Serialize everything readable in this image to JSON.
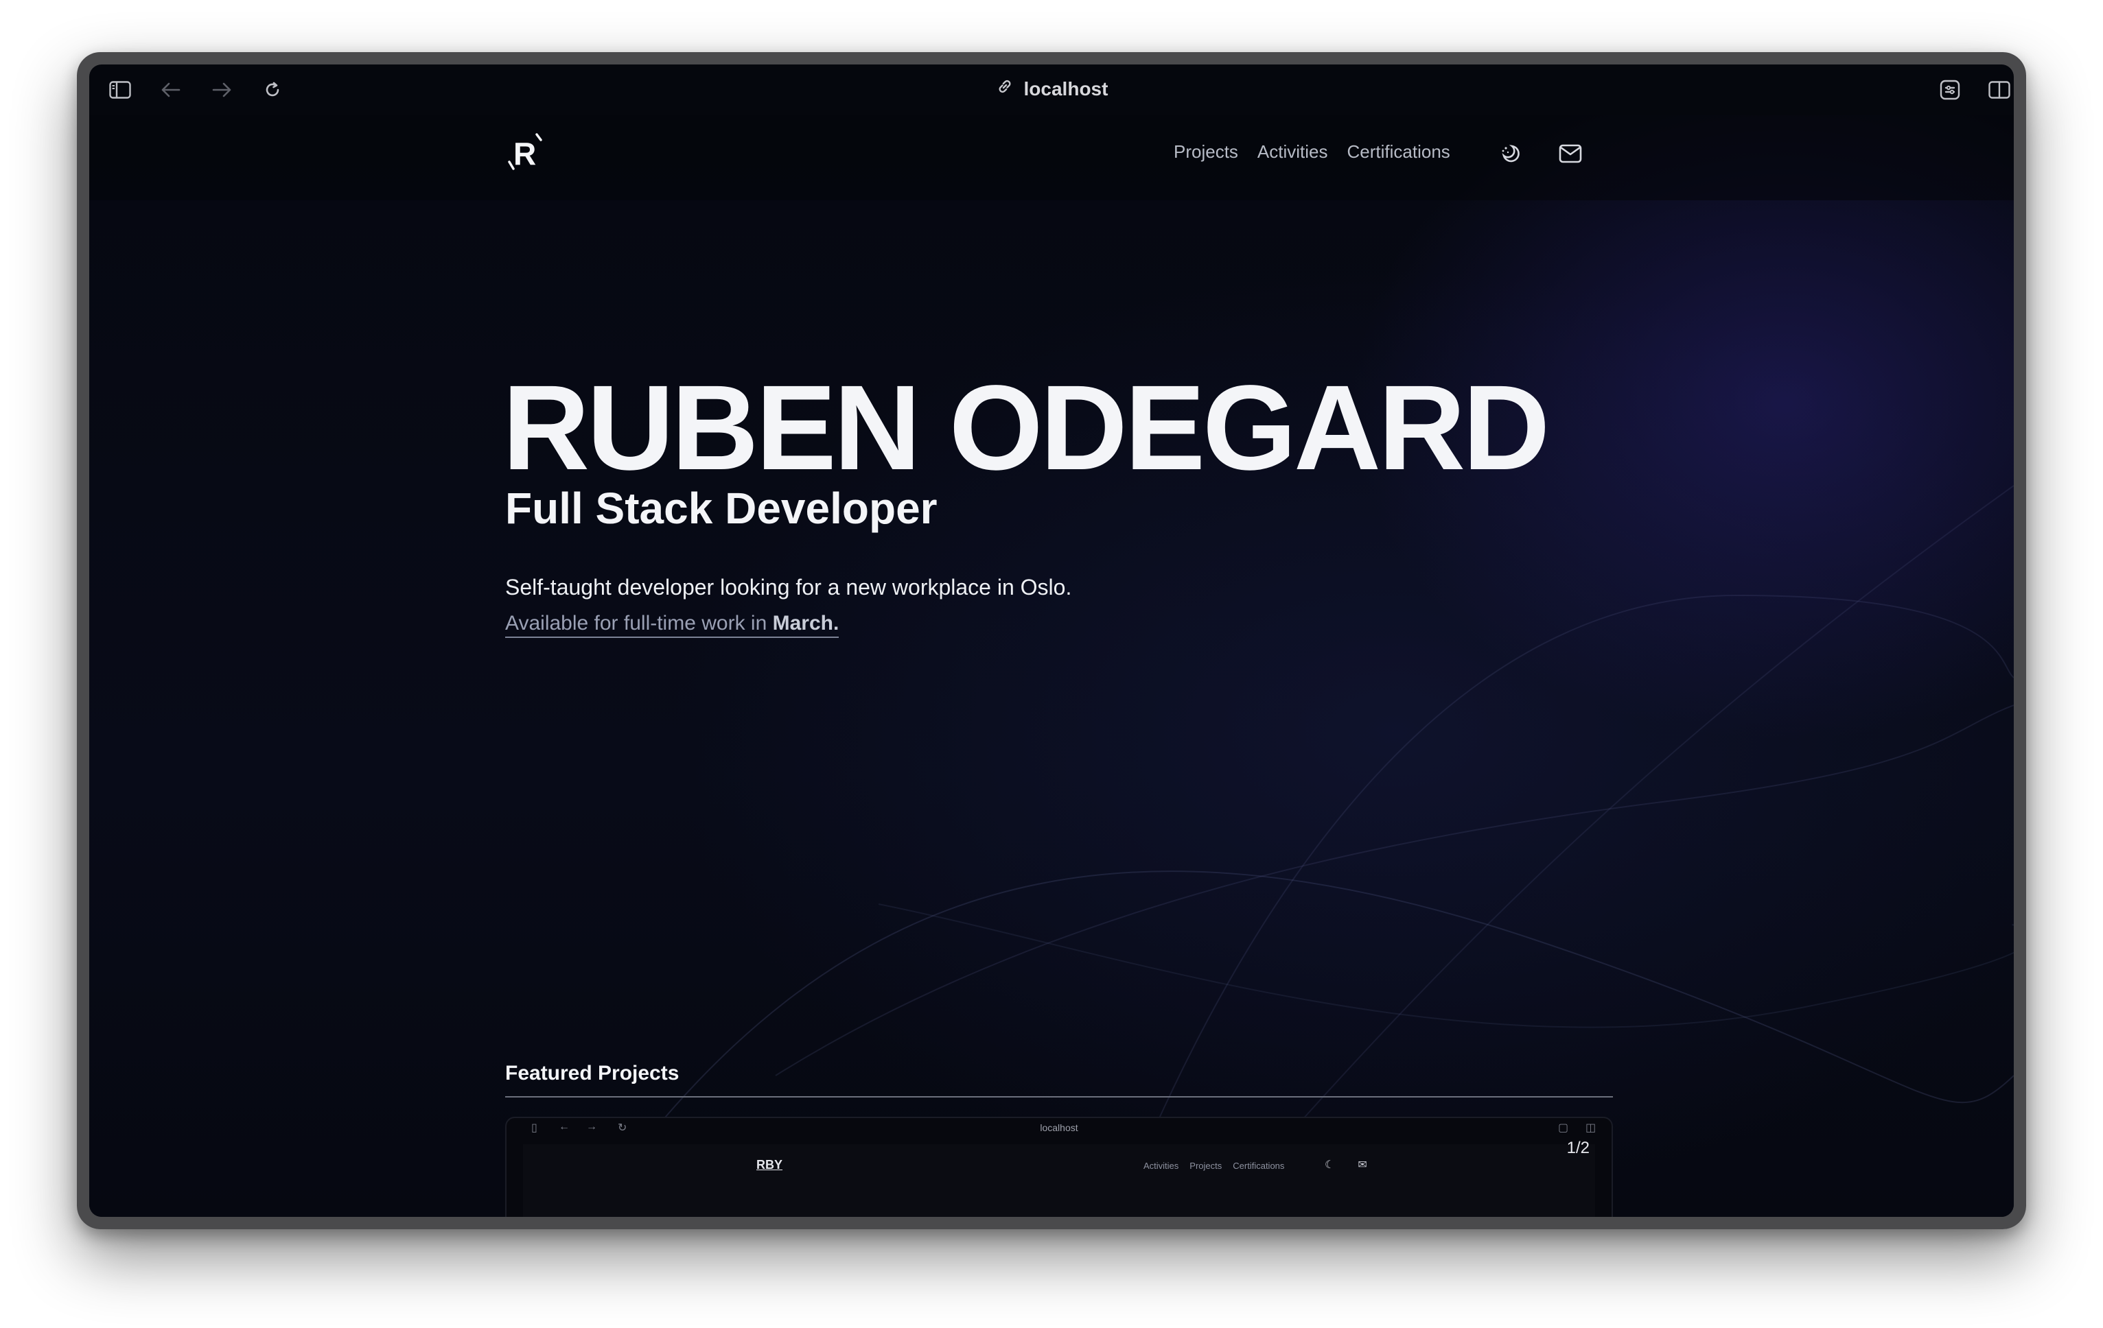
{
  "browser": {
    "url": "localhost"
  },
  "site": {
    "logo_letter": "R",
    "nav": [
      "Projects",
      "Activities",
      "Certifications"
    ],
    "hero": {
      "name": "RUBEN ODEGARD",
      "role": "Full Stack Developer",
      "description": "Self-taught developer looking for a new workplace in Oslo.",
      "availability_prefix": "Available for full-time work in ",
      "availability_month": "March."
    },
    "featured": {
      "title": "Featured Projects",
      "counter": "1/2",
      "preview": {
        "url": "localhost",
        "logo": "RBY",
        "nav": [
          "Activities",
          "Projects",
          "Certifications"
        ]
      }
    }
  },
  "icons": {
    "sidebar": "sidebar-icon",
    "back": "arrow-left-icon",
    "forward": "arrow-right-icon",
    "reload": "reload-icon",
    "link": "link-icon",
    "extensions": "extensions-icon",
    "split": "split-view-icon",
    "theme": "theme-toggle-icon",
    "mail": "mail-icon"
  },
  "colors": {
    "page_background": "#05070d",
    "accent_glow": "#26206e",
    "text_primary": "#f4f5f8",
    "text_muted": "#9aa0b4"
  }
}
